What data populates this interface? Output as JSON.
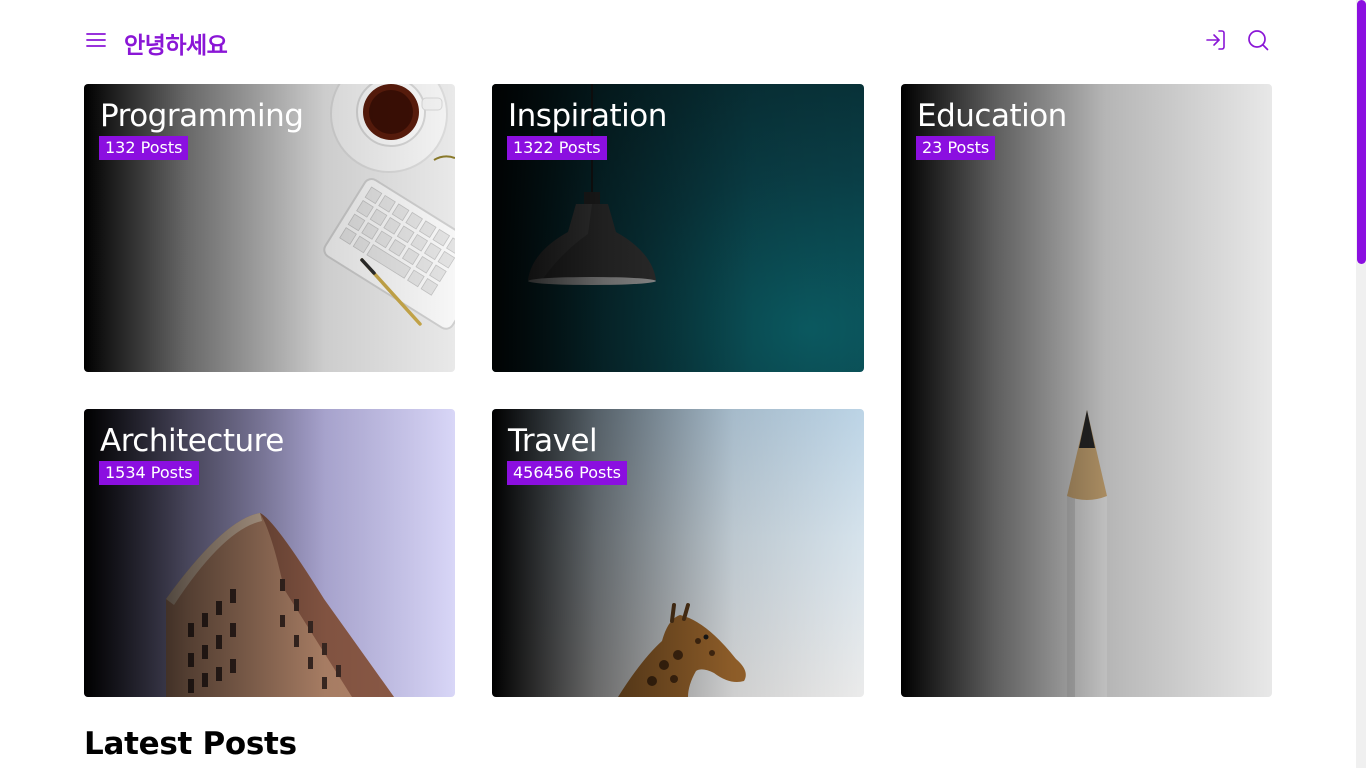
{
  "header": {
    "brand": "안녕하세요",
    "menu_icon": "hamburger-menu-icon",
    "login_icon": "sign-in-icon",
    "search_icon": "search-icon"
  },
  "categories": [
    {
      "title": "Programming",
      "count": "132 Posts"
    },
    {
      "title": "Inspiration",
      "count": "1322 Posts"
    },
    {
      "title": "Education",
      "count": "23 Posts"
    },
    {
      "title": "Architecture",
      "count": "1534 Posts"
    },
    {
      "title": "Travel",
      "count": "456456 Posts"
    }
  ],
  "sections": {
    "latest_title": "Latest Posts"
  },
  "colors": {
    "accent": "#8b0fe0",
    "brand": "#8a16d6",
    "text_dark": "#000000",
    "background": "#ffffff"
  }
}
